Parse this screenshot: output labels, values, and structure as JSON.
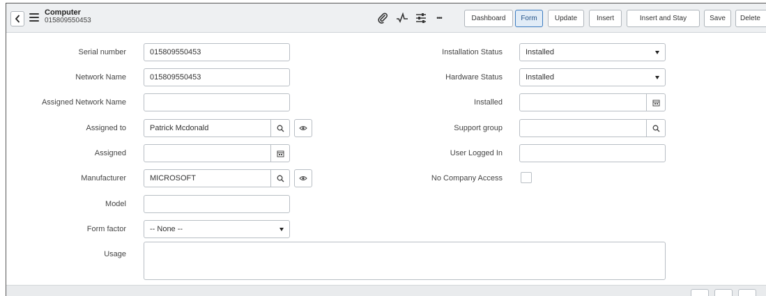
{
  "header": {
    "title": "Computer",
    "subtitle": "015809550453",
    "icons": [
      "chevron-left-icon",
      "hamburger-icon",
      "paperclip-icon",
      "activity-icon",
      "settings-sliders-icon",
      "more-icon"
    ],
    "buttons": {
      "dashboard": "Dashboard",
      "form": "Form",
      "update": "Update",
      "insert": "Insert",
      "insert_and_stay": "Insert and Stay",
      "save": "Save",
      "delete": "Delete"
    },
    "more_label": "•••"
  },
  "form": {
    "left": {
      "serial_number": {
        "label": "Serial number",
        "value": "015809550453"
      },
      "network_name": {
        "label": "Network Name",
        "value": "015809550453"
      },
      "assigned_network_name": {
        "label": "Assigned Network Name",
        "value": ""
      },
      "assigned_to": {
        "label": "Assigned to",
        "value": "Patrick Mcdonald"
      },
      "assigned": {
        "label": "Assigned",
        "value": ""
      },
      "manufacturer": {
        "label": "Manufacturer",
        "value": "MICROSOFT"
      },
      "model": {
        "label": "Model",
        "value": ""
      },
      "form_factor": {
        "label": "Form factor",
        "value": "-- None --"
      },
      "usage": {
        "label": "Usage",
        "value": ""
      }
    },
    "right": {
      "installation_status": {
        "label": "Installation Status",
        "value": "Installed"
      },
      "hardware_status": {
        "label": "Hardware Status",
        "value": "Installed"
      },
      "installed": {
        "label": "Installed",
        "value": ""
      },
      "support_group": {
        "label": "Support group",
        "value": ""
      },
      "user_logged_in": {
        "label": "User Logged In",
        "value": ""
      },
      "no_company_access": {
        "label": "No Company Access",
        "checked": false
      }
    }
  },
  "colors": {
    "header_bg": "#eef0f2",
    "active_button_border": "#3a7ac0",
    "active_button_bg": "#e1ecf7"
  }
}
